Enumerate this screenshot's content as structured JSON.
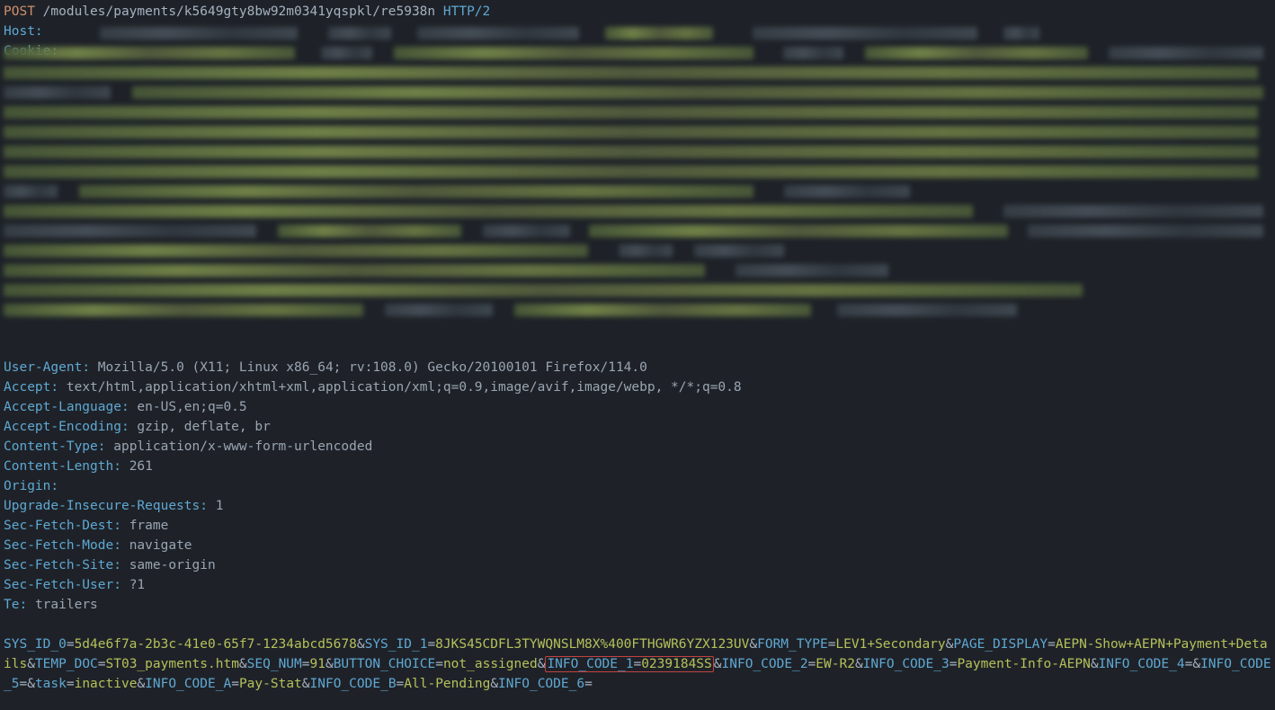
{
  "request_line": {
    "method": "POST",
    "path": "/modules/payments/k5649gty8bw92m0341yqspkl/re5938n",
    "protocol": "HTTP/2"
  },
  "headers": [
    {
      "name": "Host",
      "value": ""
    },
    {
      "name": "Cookie",
      "value": ""
    },
    {
      "name": "User-Agent",
      "value": "Mozilla/5.0 (X11; Linux x86_64; rv:108.0) Gecko/20100101 Firefox/114.0"
    },
    {
      "name": "Accept",
      "value": "text/html,application/xhtml+xml,application/xml;q=0.9,image/avif,image/webp, */*;q=0.8"
    },
    {
      "name": "Accept-Language",
      "value": "en-US,en;q=0.5"
    },
    {
      "name": "Accept-Encoding",
      "value": "gzip, deflate, br"
    },
    {
      "name": "Content-Type",
      "value": "application/x-www-form-urlencoded"
    },
    {
      "name": "Content-Length",
      "value": "261"
    },
    {
      "name": "Origin",
      "value": ""
    },
    {
      "name": "Upgrade-Insecure-Requests",
      "value": "1"
    },
    {
      "name": "Sec-Fetch-Dest",
      "value": "frame"
    },
    {
      "name": "Sec-Fetch-Mode",
      "value": "navigate"
    },
    {
      "name": "Sec-Fetch-Site",
      "value": "same-origin"
    },
    {
      "name": "Sec-Fetch-User",
      "value": "?1"
    },
    {
      "name": "Te",
      "value": "trailers"
    }
  ],
  "body_params": [
    {
      "k": "SYS_ID_0",
      "v": "5d4e6f7a-2b3c-41e0-65f7-1234abcd5678"
    },
    {
      "k": "SYS_ID_1",
      "v": "8JKS45CDFL3TYWQNSLM8X%400FTHGWR6YZX123UV"
    },
    {
      "k": "FORM_TYPE",
      "v": "LEV1+Secondary"
    },
    {
      "k": "PAGE_DISPLAY",
      "v": "AEPN-Show+AEPN+Payment+Details"
    },
    {
      "k": "TEMP_DOC",
      "v": "ST03_payments.htm"
    },
    {
      "k": "SEQ_NUM",
      "v": "91"
    },
    {
      "k": "BUTTON_CHOICE",
      "v": "not_assigned"
    },
    {
      "k": "INFO_CODE_1",
      "v": "0239184SS",
      "highlight": true
    },
    {
      "k": "INFO_CODE_2",
      "v": "EW-R2"
    },
    {
      "k": "INFO_CODE_3",
      "v": "Payment-Info-AEPN"
    },
    {
      "k": "INFO_CODE_4",
      "v": ""
    },
    {
      "k": "INFO_CODE_5",
      "v": ""
    },
    {
      "k": "task",
      "v": "inactive"
    },
    {
      "k": "INFO_CODE_A",
      "v": "Pay-Stat"
    },
    {
      "k": "INFO_CODE_B",
      "v": "All-Pending"
    },
    {
      "k": "INFO_CODE_6",
      "v": ""
    }
  ],
  "blur_lines": [
    [
      [
        "sp",
        100
      ],
      [
        "d",
        220
      ],
      [
        "sp",
        20
      ],
      [
        "d",
        70
      ],
      [
        "sp",
        15
      ],
      [
        "d",
        180
      ],
      [
        "sp",
        15
      ],
      [
        "g",
        120
      ],
      [
        "sp",
        30
      ],
      [
        "d",
        250
      ],
      [
        "sp",
        15
      ],
      [
        "d",
        40
      ]
    ],
    [
      [
        "g",
        340
      ],
      [
        "sp",
        15
      ],
      [
        "d",
        60
      ],
      [
        "sp",
        10
      ],
      [
        "g",
        420
      ],
      [
        "sp",
        20
      ],
      [
        "d",
        70
      ],
      [
        "sp",
        10
      ],
      [
        "g",
        260
      ],
      [
        "sp",
        10
      ],
      [
        "d",
        180
      ]
    ],
    [
      [
        "g",
        1395
      ]
    ],
    [
      [
        "d",
        120
      ],
      [
        "sp",
        10
      ],
      [
        "g",
        1265
      ]
    ],
    [
      [
        "g",
        1395
      ]
    ],
    [
      [
        "g",
        1395
      ]
    ],
    [
      [
        "g",
        1395
      ]
    ],
    [
      [
        "g",
        1395
      ]
    ],
    [
      [
        "d",
        60
      ],
      [
        "sp",
        10
      ],
      [
        "g",
        750
      ],
      [
        "sp",
        20
      ],
      [
        "d",
        140
      ]
    ],
    [
      [
        "g",
        1080
      ],
      [
        "sp",
        20
      ],
      [
        "d",
        290
      ]
    ],
    [
      [
        "d",
        290
      ],
      [
        "sp",
        10
      ],
      [
        "g",
        210
      ],
      [
        "sp",
        10
      ],
      [
        "d",
        100
      ],
      [
        "sp",
        8
      ],
      [
        "g",
        480
      ],
      [
        "sp",
        8
      ],
      [
        "d",
        270
      ]
    ],
    [
      [
        "g",
        650
      ],
      [
        "sp",
        20
      ],
      [
        "d",
        60
      ],
      [
        "sp",
        10
      ],
      [
        "d",
        100
      ]
    ],
    [
      [
        "g",
        780
      ],
      [
        "sp",
        20
      ],
      [
        "d",
        170
      ]
    ],
    [
      [
        "g",
        1200
      ]
    ],
    [
      [
        "g",
        400
      ],
      [
        "sp",
        10
      ],
      [
        "d",
        120
      ],
      [
        "sp",
        10
      ],
      [
        "g",
        330
      ],
      [
        "sp",
        15
      ],
      [
        "d",
        200
      ]
    ]
  ]
}
